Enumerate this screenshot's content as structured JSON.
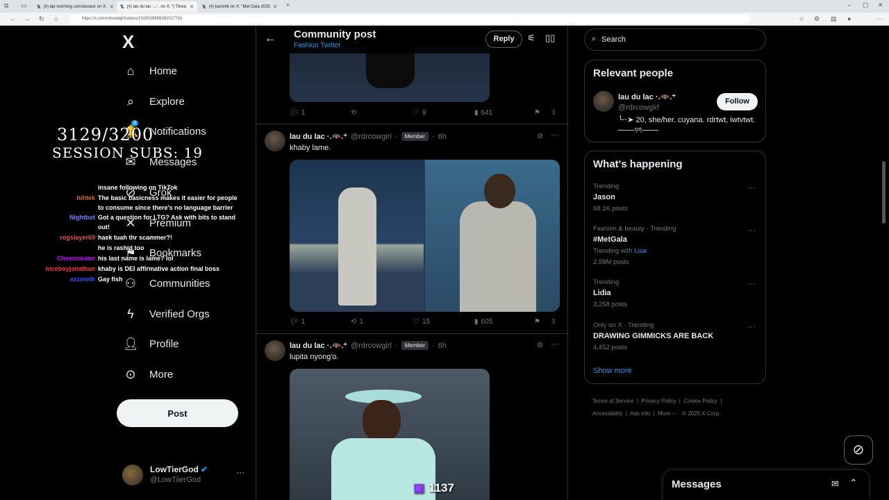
{
  "browser": {
    "tabs": [
      {
        "label": "(4) lap worming connoisseur on X:"
      },
      {
        "label": "(4) lau du lac ·.☄. on X: \"| Threa"
      },
      {
        "label": "(4) kanishk on X: \"Met Gala 2025"
      }
    ],
    "url": "https://x.com/rdrcowgirl/status/1919528656381017782"
  },
  "sidebar": {
    "logo": "X",
    "items": [
      {
        "label": "Home",
        "icon": "home-icon"
      },
      {
        "label": "Explore",
        "icon": "search-icon"
      },
      {
        "label": "Notifications",
        "icon": "bell-icon",
        "badge": "4"
      },
      {
        "label": "Messages",
        "icon": "mail-icon"
      },
      {
        "label": "Grok",
        "icon": "grok-icon"
      },
      {
        "label": "Premium",
        "icon": "x-icon"
      },
      {
        "label": "Bookmarks",
        "icon": "bookmark-icon"
      },
      {
        "label": "Communities",
        "icon": "communities-icon"
      },
      {
        "label": "Verified Orgs",
        "icon": "lightning-icon"
      },
      {
        "label": "Profile",
        "icon": "person-icon"
      },
      {
        "label": "More",
        "icon": "more-circle-icon"
      }
    ],
    "post_label": "Post",
    "account": {
      "name": "LowTierGod",
      "handle": "@LowTiierGod"
    }
  },
  "header": {
    "title": "Community post",
    "subtitle": "Fashion Twitter",
    "reply_label": "Reply"
  },
  "posts": [
    {
      "actions": {
        "replies": "1",
        "reposts": "",
        "likes": "9",
        "views": "641"
      }
    },
    {
      "name": "lau du lac ·.🦇.⁺",
      "handle": "@rdrcowgirl",
      "badge": "Member",
      "time": "6h",
      "text": "khaby lame.",
      "actions": {
        "replies": "1",
        "reposts": "1",
        "likes": "15",
        "views": "605"
      }
    },
    {
      "name": "lau du lac ·.🦇.⁺",
      "handle": "@rdrcowgirl",
      "badge": "Member",
      "time": "6h",
      "text": "lupita nyong'o."
    }
  ],
  "right": {
    "search_placeholder": "Search",
    "relevant": {
      "title": "Relevant people",
      "name": "lau du lac ·.🦇.⁺",
      "handle": "@rdrcowgirl",
      "follow_label": "Follow",
      "bio": "╰┈➤ 20, she/her. cuyana. rdrtwt, iwtvtwt. ───୨ৎ───"
    },
    "happening": {
      "title": "What's happening",
      "trends": [
        {
          "meta": "Trending",
          "title": "Jason",
          "posts": "68.1K posts"
        },
        {
          "meta": "Fashion & beauty · Trending",
          "title": "#MetGala",
          "with_label": "Trending with",
          "with_link": "Lisa",
          "posts": "2.88M posts"
        },
        {
          "meta": "Trending",
          "title": "Lidia",
          "posts": "3,258 posts"
        },
        {
          "meta": "Only on X · Trending",
          "title": "DRAWING GIMMICKS ARE BACK",
          "posts": "4,452 posts"
        }
      ],
      "show_more": "Show more"
    },
    "footer": {
      "links": [
        "Terms of Service",
        "Privacy Policy",
        "Cookie Policy",
        "Accessibility",
        "Ads info",
        "More ···"
      ],
      "copyright": "© 2025 X Corp."
    },
    "messages_label": "Messages"
  },
  "overlay": {
    "counter": "3129/3200",
    "session": "SESSION SUBS: 19",
    "viewers": "1137",
    "chat": [
      {
        "user": "",
        "text": "insane following on TikTok",
        "color": "#ffffff"
      },
      {
        "user": "hihtek",
        "text": "The basic basicness makes it easier for people",
        "color": "#d2691e"
      },
      {
        "user": "",
        "text": "to consume since there's no language barrier",
        "color": "#ffffff"
      },
      {
        "user": "Nightbot",
        "text": "Got a question for LTG? Ask with bits to stand",
        "color": "#7c7cff"
      },
      {
        "user": "",
        "text": "out!",
        "color": "#ffffff"
      },
      {
        "user": "rogslayer69",
        "text": "haek tuah thr scammer?!",
        "color": "#e05050"
      },
      {
        "user": "",
        "text": "he is rashid too",
        "color": "#ffffff"
      },
      {
        "user": "Cheerioeater",
        "text": "his last name is lame? lol",
        "color": "#c000ff"
      },
      {
        "user": "niceboyjonathan",
        "text": "khaby is DEI affirmative action final boss",
        "color": "#ff3030"
      },
      {
        "user": "azzmoth",
        "text": "Gay fish",
        "color": "#3050ff"
      }
    ]
  },
  "colors": {
    "accent": "#1d9bf0",
    "background": "#000000",
    "border": "#2f3336",
    "muted": "#71767b"
  }
}
